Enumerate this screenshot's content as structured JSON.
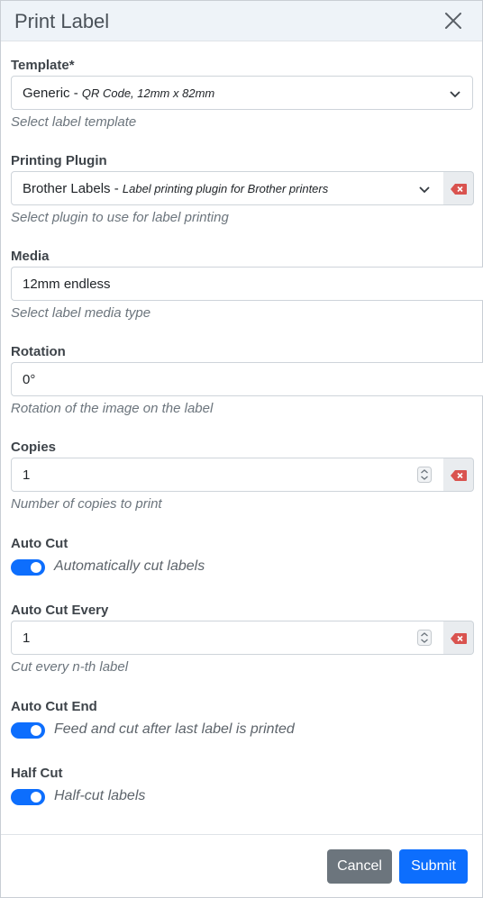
{
  "dialog": {
    "title": "Print Label"
  },
  "template": {
    "label": "Template*",
    "value_main": "Generic - ",
    "value_sub": "QR Code, 12mm x 82mm",
    "help": "Select label template"
  },
  "plugin": {
    "label": "Printing Plugin",
    "value_main": "Brother Labels - ",
    "value_sub": "Label printing plugin for Brother printers",
    "help": "Select plugin to use for label printing"
  },
  "media": {
    "label": "Media",
    "value": "12mm endless",
    "help": "Select label media type"
  },
  "rotation": {
    "label": "Rotation",
    "value": "0°",
    "help": "Rotation of the image on the label"
  },
  "copies": {
    "label": "Copies",
    "value": "1",
    "help": "Number of copies to print"
  },
  "auto_cut": {
    "label": "Auto Cut",
    "toggle_text": "Automatically cut labels",
    "on": true
  },
  "auto_cut_every": {
    "label": "Auto Cut Every",
    "value": "1",
    "help": "Cut every n-th label"
  },
  "auto_cut_end": {
    "label": "Auto Cut End",
    "toggle_text": "Feed and cut after last label is printed",
    "on": true
  },
  "half_cut": {
    "label": "Half Cut",
    "toggle_text": "Half-cut labels",
    "on": true
  },
  "footer": {
    "cancel_label": "Cancel",
    "submit_label": "Submit"
  },
  "colors": {
    "primary": "#0d6efd",
    "secondary": "#6c757d",
    "clear_icon": "#d9534f",
    "header_bg": "#eef3f8"
  },
  "icons": {
    "close": "close-icon",
    "dropdown": "chevron-down-icon",
    "clear": "clear-field-icon",
    "spinner": "number-spinner-icon"
  }
}
